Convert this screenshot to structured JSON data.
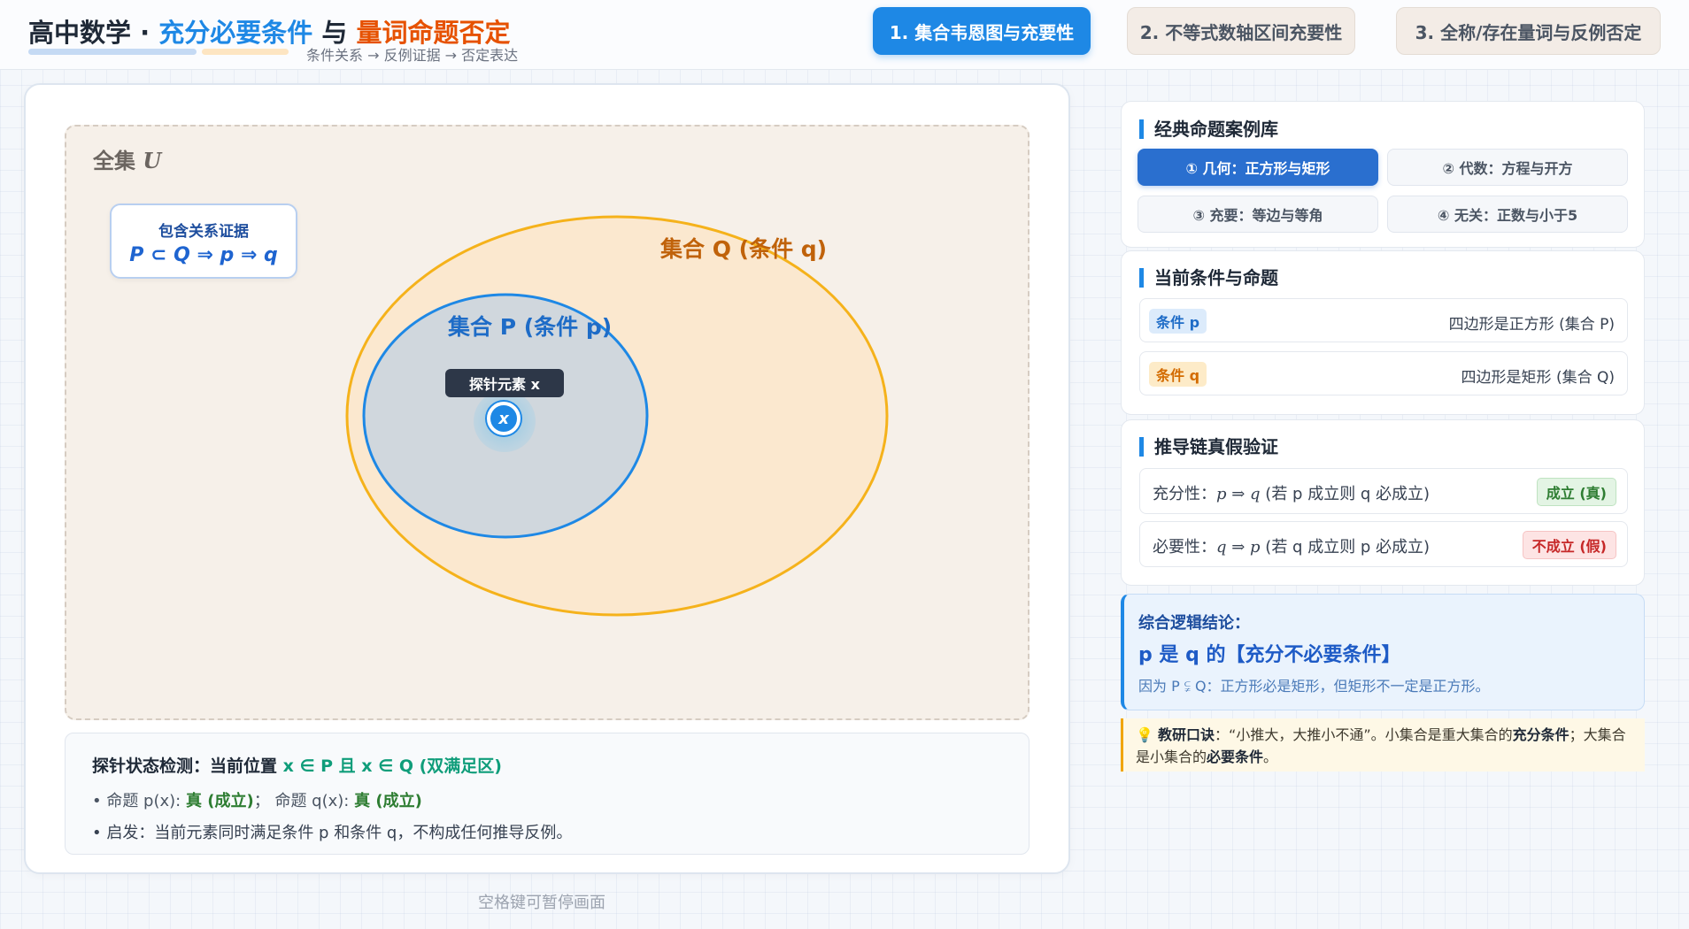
{
  "header": {
    "title_prefix": "高中数学 · ",
    "title_blue": "充分必要条件",
    "title_mid": " 与 ",
    "title_orange": "量词命题否定",
    "subtitle": "条件关系 → 反例证据 → 否定表达",
    "tabs": [
      {
        "label": "1. 集合韦恩图与充要性",
        "active": true
      },
      {
        "label": "2. 不等式数轴区间充要性",
        "active": false
      },
      {
        "label": "3. 全称/存在量词与反例否定",
        "active": false
      }
    ]
  },
  "venn": {
    "universe_label": "全集",
    "universe_symbol": "U",
    "proof_title": "包含关系证据",
    "proof_formula": "P ⊂ Q ⇒ p ⇒ q",
    "set_q_label": "集合 Q (条件 q)",
    "set_p_label": "集合 P (条件 p)",
    "probe_tooltip": "探针元素 x",
    "probe_symbol": "x",
    "colors": {
      "set_p": "#1e88e5",
      "set_q": "#f5b21b"
    }
  },
  "status": {
    "line1_prefix": "探针状态检测：当前位置 ",
    "line1_value": "x ∈ P 且 x ∈ Q (双满足区)",
    "line2_p_label": "• 命题 p(x): ",
    "line2_p_value": "真 (成立)",
    "line2_sep": "；  命题 q(x): ",
    "line2_q_value": "真 (成立)",
    "line3": "• 启发：当前元素同时满足条件 p 和条件 q，不构成任何推导反例。"
  },
  "pause_hint": "空格键可暂停画面",
  "case_library": {
    "title": "经典命题案例库",
    "cases": [
      {
        "label": "① 几何：正方形与矩形",
        "active": true
      },
      {
        "label": "② 代数：方程与开方",
        "active": false
      },
      {
        "label": "③ 充要：等边与等角",
        "active": false
      },
      {
        "label": "④ 无关：正数与小于5",
        "active": false
      }
    ]
  },
  "conditions": {
    "title": "当前条件与命题",
    "p_badge": "条件 p",
    "p_text": "四边形是正方形 (集合 P)",
    "q_badge": "条件 q",
    "q_text": "四边形是矩形 (集合 Q)"
  },
  "chain": {
    "title": "推导链真假验证",
    "sufficiency_label": "充分性：",
    "sufficiency_formula": "p ⇒ q",
    "sufficiency_desc": " (若 p 成立则 q 必成立)",
    "sufficiency_verdict": "成立 (真)",
    "necessity_label": "必要性：",
    "necessity_formula": "q ⇒ p",
    "necessity_desc": " (若 q 成立则 p 必成立)",
    "necessity_verdict": "不成立 (假)"
  },
  "conclusion": {
    "head": "综合逻辑结论：",
    "main": "p 是 q 的【充分不必要条件】",
    "note": "因为 P ⫋ Q：正方形必是矩形，但矩形不一定是正方形。"
  },
  "tip": {
    "icon": "💡",
    "label": "教研口诀",
    "text1": "：“小推大，大推小不通”。小集合是重大集合的",
    "bold1": "充分条件",
    "text2": "；大集合是小集合的",
    "bold2": "必要条件",
    "text3": "。"
  }
}
